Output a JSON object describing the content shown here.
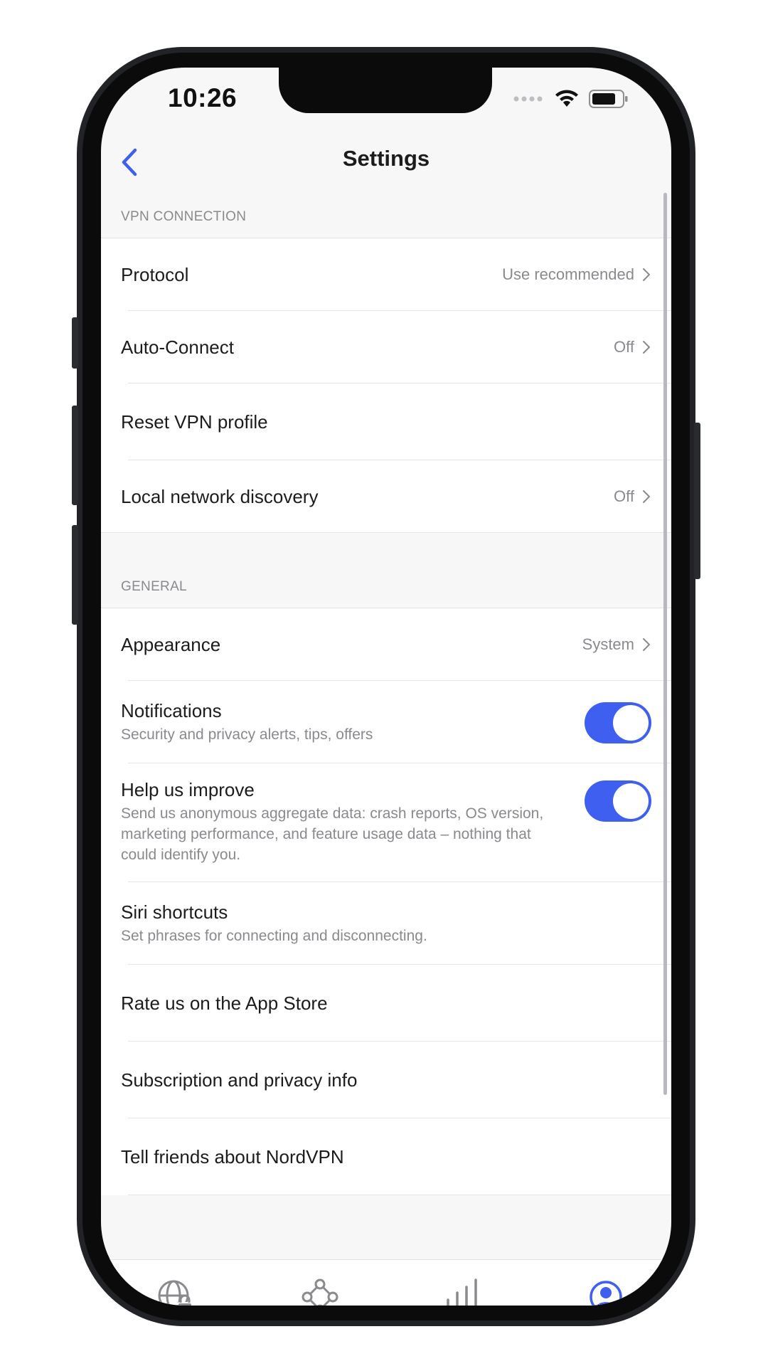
{
  "status_bar": {
    "time": "10:26"
  },
  "nav": {
    "title": "Settings",
    "back_icon": "chevron-left-icon"
  },
  "sections": {
    "vpn": {
      "header": "VPN CONNECTION",
      "protocol": {
        "label": "Protocol",
        "value": "Use recommended"
      },
      "auto_connect": {
        "label": "Auto-Connect",
        "value": "Off"
      },
      "reset_profile": {
        "label": "Reset VPN profile"
      },
      "local_network": {
        "label": "Local network discovery",
        "value": "Off"
      }
    },
    "general": {
      "header": "GENERAL",
      "appearance": {
        "label": "Appearance",
        "value": "System"
      },
      "notifications": {
        "label": "Notifications",
        "subtitle": "Security and privacy alerts, tips, offers",
        "enabled": true
      },
      "help_improve": {
        "label": "Help us improve",
        "subtitle": "Send us anonymous aggregate data: crash reports, OS version, marketing performance, and feature usage data – nothing that could identify you.",
        "enabled": true
      },
      "siri": {
        "label": "Siri shortcuts",
        "subtitle": "Set phrases for connecting and disconnecting."
      },
      "rate": {
        "label": "Rate us on the App Store"
      },
      "subscription": {
        "label": "Subscription and privacy info"
      },
      "tell_friends": {
        "label": "Tell friends about NordVPN"
      }
    }
  },
  "tab_bar": {
    "tabs": [
      {
        "icon": "globe-lock-icon",
        "active": false
      },
      {
        "icon": "meshnet-icon",
        "active": false
      },
      {
        "icon": "stats-bars-icon",
        "active": false
      },
      {
        "icon": "profile-icon",
        "active": true
      }
    ]
  },
  "colors": {
    "accent": "#3e5ff0",
    "secondary_text": "#8a8a8e",
    "tab_inactive": "#8a8a8e"
  }
}
